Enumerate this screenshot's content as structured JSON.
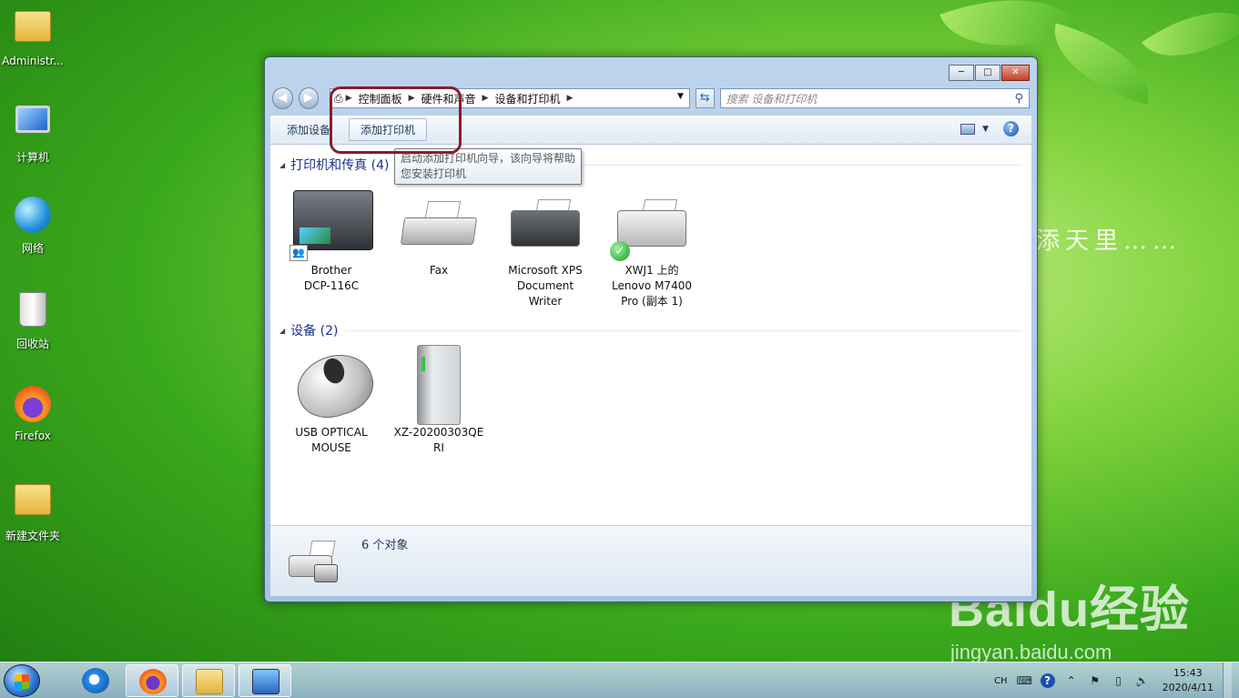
{
  "desktop": {
    "icons": [
      {
        "label": "Administr..."
      },
      {
        "label": "计算机"
      },
      {
        "label": "网络"
      },
      {
        "label": "回收站"
      },
      {
        "label": "Firefox"
      },
      {
        "label": "新建文件夹"
      }
    ],
    "wallpaper_text": "添天里……",
    "watermark": {
      "brand": "Baidu经验",
      "url": "jingyan.baidu.com"
    }
  },
  "window": {
    "controls": {
      "minimize": "─",
      "maximize": "□",
      "close": "✕"
    },
    "nav": {
      "back": "◀",
      "forward": "▶"
    },
    "address": {
      "crumbs": [
        "控制面板",
        "硬件和声音",
        "设备和打印机"
      ]
    },
    "search": {
      "placeholder": "搜索 设备和打印机"
    },
    "toolbar": {
      "add_device": "添加设备",
      "add_printer": "添加打印机"
    },
    "groups": {
      "printers": {
        "title": "打印机和传真 (4)",
        "items": [
          {
            "line1": "Brother",
            "line2": "DCP-116C",
            "line3": ""
          },
          {
            "line1": "Fax",
            "line2": "",
            "line3": ""
          },
          {
            "line1": "Microsoft XPS",
            "line2": "Document",
            "line3": "Writer"
          },
          {
            "line1": "XWJ1 上的",
            "line2": "Lenovo M7400",
            "line3": "Pro (副本 1)"
          }
        ]
      },
      "devices": {
        "title": "设备 (2)",
        "items": [
          {
            "line1": "USB OPTICAL",
            "line2": "MOUSE"
          },
          {
            "line1": "XZ-20200303QE",
            "line2": "RI"
          }
        ]
      }
    },
    "status": {
      "count": "6 个对象"
    },
    "tooltip": {
      "line1": "启动添加打印机向导，该向导将帮助",
      "line2": "您安装打印机"
    }
  },
  "taskbar": {
    "tray": {
      "lang": "CH",
      "time": "15:43",
      "date": "2020/4/11"
    }
  },
  "colors": {
    "highlight": "#8b1c2b",
    "group_title": "#1e3287"
  }
}
